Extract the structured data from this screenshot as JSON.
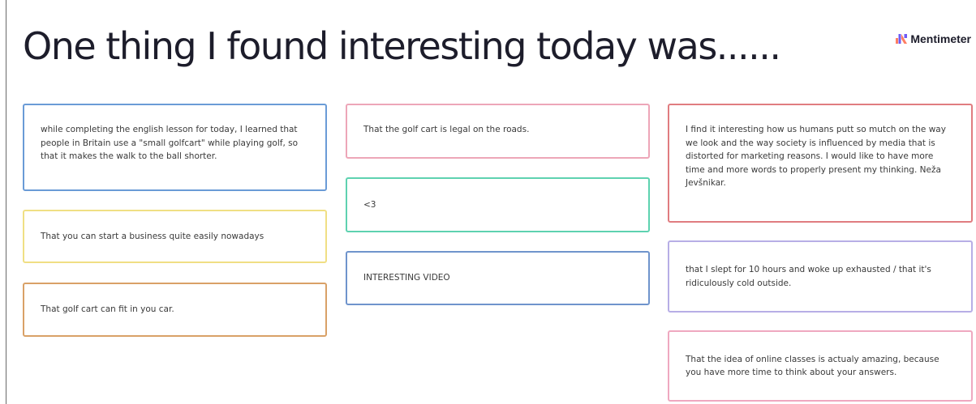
{
  "title": "One thing I found interesting today was......",
  "brand": {
    "name": "Mentimeter",
    "logo_icon": "mentimeter-logo-icon",
    "logo_colors": [
      "#ff7e63",
      "#6e5cf6"
    ]
  },
  "cards": [
    {
      "text": "while completing the english lesson for today, I learned that people in Britain use a \"small golfcart\" while playing golf, so that it makes the walk to the ball shorter.",
      "border_color": "#6a9bd6"
    },
    {
      "text": "That you can start a business quite easily nowadays",
      "border_color": "#f0df84"
    },
    {
      "text": "That golf cart can fit in you car.",
      "border_color": "#d9a167"
    },
    {
      "text": "That the golf cart is legal on the roads.",
      "border_color": "#eda6b8"
    },
    {
      "text": "<3",
      "border_color": "#5ed2b0"
    },
    {
      "text": "INTERESTING VIDEO",
      "border_color": "#6f94cc"
    },
    {
      "text": "I find it interesting how us humans putt so mutch on the way we look and the way society is influenced by media that is distorted for marketing reasons. I would like to have more time and more words to properly present my thinking. Neža Jevšnikar.",
      "border_color": "#e07c80"
    },
    {
      "text": "that I slept for 10 hours and woke up exhausted / that it's ridiculously cold outside.",
      "border_color": "#b7aee6"
    },
    {
      "text": "That the idea of online classes is actualy amazing, because you have more time to think about your answers.",
      "border_color": "#efa8c0"
    }
  ]
}
